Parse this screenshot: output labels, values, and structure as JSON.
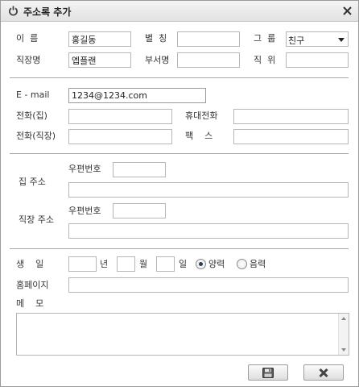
{
  "window": {
    "title": "주소록 추가"
  },
  "personal": {
    "name_label": "이  름",
    "name_value": "홍길동",
    "nickname_label": "별  칭",
    "nickname_value": "",
    "group_label": "그  룹",
    "group_selected": "친구",
    "company_label": "직장명",
    "company_value": "엡플랜",
    "department_label": "부서명",
    "department_value": "",
    "position_label": "직  위",
    "position_value": ""
  },
  "contact": {
    "email_label": "E - mail",
    "email_value": "1234@1234.com",
    "home_phone_label": "전화(집)",
    "home_phone_value": "",
    "mobile_label": "휴대전화",
    "mobile_value": "",
    "work_phone_label": "전화(직장)",
    "work_phone_value": "",
    "fax_label": "팩    스",
    "fax_value": ""
  },
  "address": {
    "home_label": "집 주소",
    "home_zip_label": "우편번호",
    "home_zip_value": "",
    "home_address_value": "",
    "work_label": "직장 주소",
    "work_zip_label": "우편번호",
    "work_zip_value": "",
    "work_address_value": ""
  },
  "extra": {
    "birthday_label": "생    일",
    "year_value": "",
    "year_label": "년",
    "month_value": "",
    "month_label": "월",
    "day_value": "",
    "day_label": "일",
    "solar_label": "양력",
    "lunar_label": "음력",
    "calendar_selected": "solar",
    "homepage_label": "홈페이지",
    "homepage_value": "",
    "memo_label": "메    모",
    "memo_value": ""
  },
  "icons": {
    "title": "power-icon",
    "close": "close-icon",
    "save": "floppy-disk-icon",
    "cancel": "x-icon"
  }
}
